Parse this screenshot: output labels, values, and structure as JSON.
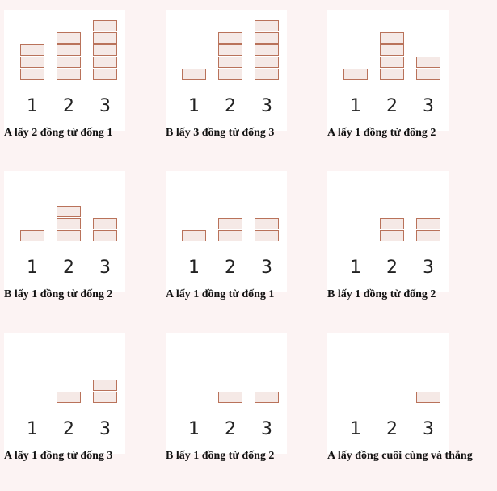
{
  "colors": {
    "page_background": "#fcf3f3",
    "card_background": "#ffffff",
    "coin_fill": "#f5e9e6",
    "coin_border": "#b9725a",
    "text": "#111111"
  },
  "pile_labels": [
    "1",
    "2",
    "3"
  ],
  "steps": [
    {
      "caption": "A lấy 2 đồng từ đống 1",
      "piles": [
        3,
        4,
        5
      ]
    },
    {
      "caption": "B lấy 3 đồng từ đống 3",
      "piles": [
        1,
        4,
        5
      ]
    },
    {
      "caption": "A lấy 1 đồng từ đống 2",
      "piles": [
        1,
        4,
        2
      ]
    },
    {
      "caption": "B lấy 1 đồng từ đống 2",
      "piles": [
        1,
        3,
        2
      ]
    },
    {
      "caption": "A lấy 1 đồng từ đống 1",
      "piles": [
        1,
        2,
        2
      ]
    },
    {
      "caption": "B lấy 1 đồng từ đống 2",
      "piles": [
        0,
        2,
        2
      ]
    },
    {
      "caption": "A lấy 1 đồng từ đống 3",
      "piles": [
        0,
        1,
        2
      ]
    },
    {
      "caption": "B lấy 1 đồng từ đống 2",
      "piles": [
        0,
        1,
        1
      ]
    },
    {
      "caption": "A lấy đồng cuối cùng và thắng",
      "piles": [
        0,
        0,
        1
      ]
    }
  ]
}
